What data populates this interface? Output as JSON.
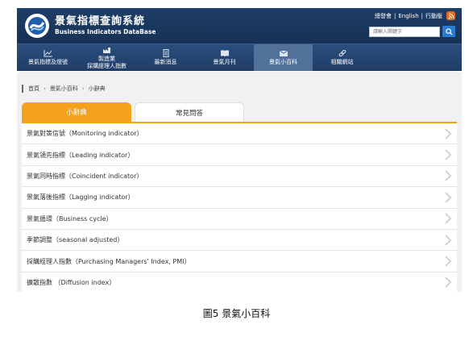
{
  "header": {
    "title_zh": "景氣指標查詢系統",
    "title_en": "Business Indicators DataBase",
    "top_links": [
      "總發會",
      "English",
      "行動版"
    ],
    "search_placeholder": "請輸入關鍵字"
  },
  "nav": {
    "items": [
      {
        "label": "景氣指標及燈號",
        "icon": "line-chart-icon"
      },
      {
        "label": "製造業\n採購經理人指數",
        "icon": "factory-icon"
      },
      {
        "label": "最新消息",
        "icon": "news-icon"
      },
      {
        "label": "景氣月刊",
        "icon": "book-icon"
      },
      {
        "label": "景氣小百科",
        "icon": "encyclopedia-icon",
        "active": true
      },
      {
        "label": "相關網站",
        "icon": "link-icon"
      }
    ]
  },
  "breadcrumb": [
    "首頁",
    "景氣小百科",
    "小辭典"
  ],
  "tabs": [
    {
      "label": "小辭典",
      "active": true
    },
    {
      "label": "常見問答",
      "active": false
    }
  ],
  "list": [
    "景氣對策信號（Monitoring indicator）",
    "景氣領先指標（Leading indicator）",
    "景氣同時指標（Coincident indicator）",
    "景氣落後指標（Lagging indicator）",
    "景氣循環（Business cycle）",
    "季節調整（seasonal adjusted）",
    "採購經理人指數（Purchasing Managers' Index, PMI）",
    "擴散指數 （Diffusion index）"
  ],
  "caption": "圖5 景氣小百科",
  "colors": {
    "header_bg": "#1f3e68",
    "nav_bg": "#2b4e7d",
    "accent": "#f4a11b",
    "search_button": "#2a7bd4",
    "rss": "#e66b1a"
  }
}
